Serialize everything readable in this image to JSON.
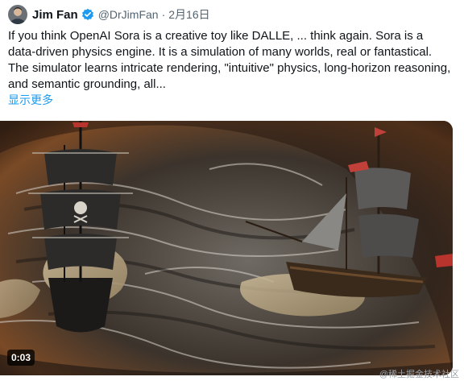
{
  "tweet": {
    "author_name": "Jim Fan",
    "handle": "@DrJimFan",
    "separator": "·",
    "date": "2月16日",
    "text": "If you think OpenAI Sora is a creative toy like DALLE, ... think again. Sora is a data-driven physics engine. It is a simulation of many worlds, real or fantastical. The simulator learns intricate rendering, \"intuitive\" physics, long-horizon reasoning, and semantic grounding, all...",
    "show_more": "显示更多"
  },
  "media": {
    "duration": "0:03"
  },
  "watermark": "@稀土掘金技术社区",
  "colors": {
    "link": "#1d9bf0",
    "verified": "#1d9bf0",
    "secondary_text": "#536471"
  }
}
